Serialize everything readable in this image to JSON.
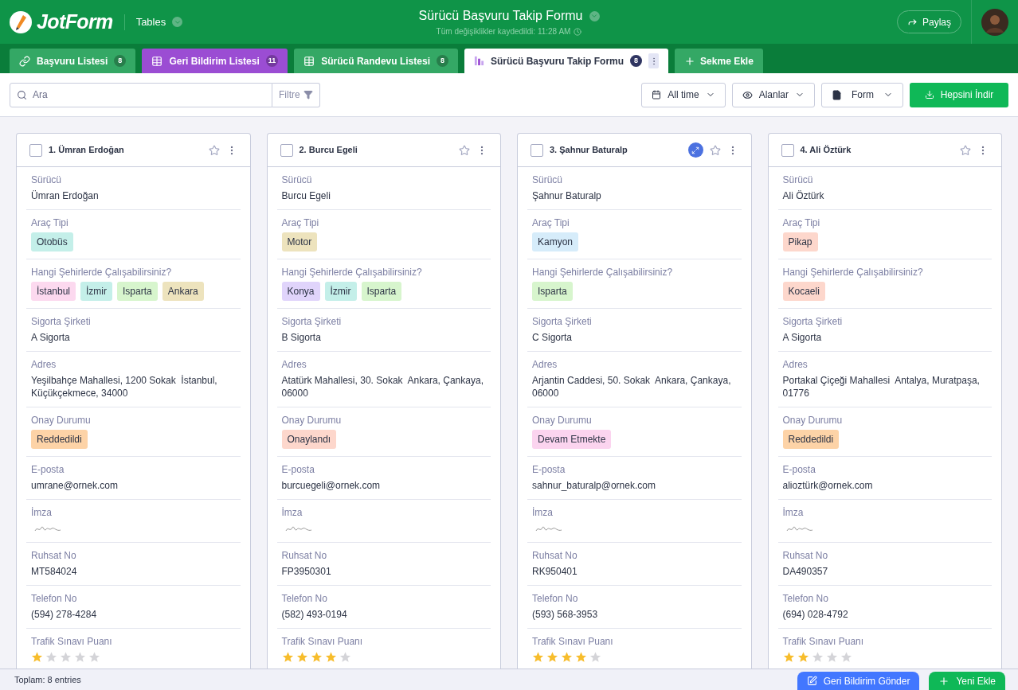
{
  "header": {
    "logo": "JotForm",
    "app": "Tables",
    "title": "Sürücü Başvuru Takip Formu",
    "saved": "Tüm değişiklikler kaydedildi: 11:28 AM",
    "share": "Paylaş"
  },
  "tabs": [
    {
      "label": "Başvuru Listesi",
      "count": "8",
      "kind": "link",
      "color": "#34a865",
      "selected": false
    },
    {
      "label": "Geri Bildirim Listesi",
      "count": "11",
      "kind": "table",
      "color": "#9b4dd3",
      "selected": false
    },
    {
      "label": "Sürücü Randevu Listesi",
      "count": "8",
      "kind": "table",
      "color": "#34a865",
      "selected": false
    },
    {
      "label": "Sürücü Başvuru Takip Formu",
      "count": "8",
      "kind": "report",
      "color": "#ffffff",
      "selected": true
    }
  ],
  "add_tab": "Sekme Ekle",
  "toolbar": {
    "search": {
      "placeholder": "Ara"
    },
    "filter": "Filtre",
    "date": "All time",
    "fields": "Alanlar",
    "form": "Form",
    "download": "Hepsini İndir"
  },
  "cards": [
    {
      "title": "1. Ümran Erdoğan",
      "checked": false,
      "starred": false,
      "hovered": false,
      "fields": [
        {
          "kind": "text",
          "label": "Sürücü",
          "value": "Ümran Erdoğan"
        },
        {
          "kind": "tags",
          "label": "Araç Tipi",
          "tags": [
            {
              "text": "Otobüs",
              "color": "#c4efe9"
            }
          ]
        },
        {
          "kind": "tags",
          "label": "Hangi Şehirlerde Çalışabilirsiniz?",
          "tags": [
            {
              "text": "İstanbul",
              "color": "#fcd9ef"
            },
            {
              "text": "İzmir",
              "color": "#c4efe9"
            },
            {
              "text": "Isparta",
              "color": "#d7f5cd"
            },
            {
              "text": "Ankara",
              "color": "#ede3bd"
            }
          ]
        },
        {
          "kind": "text",
          "label": "Sigorta Şirketi",
          "value": "A Sigorta"
        },
        {
          "kind": "text",
          "label": "Adres",
          "value": "Yeşilbahçe Mahallesi, 1200 Sokak  İstanbul, Küçükçekmece, 34000"
        },
        {
          "kind": "tags",
          "label": "Onay Durumu",
          "tags": [
            {
              "text": "Reddedildi",
              "color": "#fdd3a7"
            }
          ]
        },
        {
          "kind": "text",
          "label": "E-posta",
          "value": "umrane@ornek.com"
        },
        {
          "kind": "signature",
          "label": "İmza"
        },
        {
          "kind": "text",
          "label": "Ruhsat No",
          "value": "MT584024"
        },
        {
          "kind": "text",
          "label": "Telefon No",
          "value": "(594) 278-4284"
        },
        {
          "kind": "stars",
          "label": "Trafik Sınavı Puanı",
          "stars": 1
        }
      ]
    },
    {
      "title": "2. Burcu Egeli",
      "checked": false,
      "starred": false,
      "hovered": false,
      "fields": [
        {
          "kind": "text",
          "label": "Sürücü",
          "value": "Burcu Egeli"
        },
        {
          "kind": "tags",
          "label": "Araç Tipi",
          "tags": [
            {
              "text": "Motor",
              "color": "#ede3bd"
            }
          ]
        },
        {
          "kind": "tags",
          "label": "Hangi Şehirlerde Çalışabilirsiniz?",
          "tags": [
            {
              "text": "Konya",
              "color": "#e0d4fb"
            },
            {
              "text": "İzmir",
              "color": "#c4efe9"
            },
            {
              "text": "Isparta",
              "color": "#d7f5cd"
            }
          ]
        },
        {
          "kind": "text",
          "label": "Sigorta Şirketi",
          "value": "B Sigorta"
        },
        {
          "kind": "text",
          "label": "Adres",
          "value": "Atatürk Mahallesi, 30. Sokak  Ankara, Çankaya, 06000"
        },
        {
          "kind": "tags",
          "label": "Onay Durumu",
          "tags": [
            {
              "text": "Onaylandı",
              "color": "#fdd7cc"
            }
          ]
        },
        {
          "kind": "text",
          "label": "E-posta",
          "value": "burcuegeli@ornek.com"
        },
        {
          "kind": "signature",
          "label": "İmza"
        },
        {
          "kind": "text",
          "label": "Ruhsat No",
          "value": "FP3950301"
        },
        {
          "kind": "text",
          "label": "Telefon No",
          "value": "(582) 493-0194"
        },
        {
          "kind": "stars",
          "label": "Trafik Sınavı Puanı",
          "stars": 4
        }
      ]
    },
    {
      "title": "3. Şahnur Baturalp",
      "checked": false,
      "starred": false,
      "hovered": true,
      "fields": [
        {
          "kind": "text",
          "label": "Sürücü",
          "value": "Şahnur Baturalp"
        },
        {
          "kind": "tags",
          "label": "Araç Tipi",
          "tags": [
            {
              "text": "Kamyon",
              "color": "#d6ecfa"
            }
          ]
        },
        {
          "kind": "tags",
          "label": "Hangi Şehirlerde Çalışabilirsiniz?",
          "tags": [
            {
              "text": "Isparta",
              "color": "#d7f5cd"
            }
          ]
        },
        {
          "kind": "text",
          "label": "Sigorta Şirketi",
          "value": "C Sigorta"
        },
        {
          "kind": "text",
          "label": "Adres",
          "value": "Arjantin Caddesi, 50. Sokak  Ankara, Çankaya, 06000"
        },
        {
          "kind": "tags",
          "label": "Onay Durumu",
          "tags": [
            {
              "text": "Devam Etmekte",
              "color": "#fbd4ef"
            }
          ]
        },
        {
          "kind": "text",
          "label": "E-posta",
          "value": "sahnur_baturalp@ornek.com"
        },
        {
          "kind": "signature",
          "label": "İmza"
        },
        {
          "kind": "text",
          "label": "Ruhsat No",
          "value": "RK950401"
        },
        {
          "kind": "text",
          "label": "Telefon No",
          "value": "(593) 568-3953"
        },
        {
          "kind": "stars",
          "label": "Trafik Sınavı Puanı",
          "stars": 4
        }
      ]
    },
    {
      "title": "4. Ali Öztürk",
      "checked": false,
      "starred": false,
      "hovered": false,
      "fields": [
        {
          "kind": "text",
          "label": "Sürücü",
          "value": "Ali Öztürk"
        },
        {
          "kind": "tags",
          "label": "Araç Tipi",
          "tags": [
            {
              "text": "Pikap",
              "color": "#fdd7cc"
            }
          ]
        },
        {
          "kind": "tags",
          "label": "Hangi Şehirlerde Çalışabilirsiniz?",
          "tags": [
            {
              "text": "Kocaeli",
              "color": "#fdd7cc"
            }
          ]
        },
        {
          "kind": "text",
          "label": "Sigorta Şirketi",
          "value": "A Sigorta"
        },
        {
          "kind": "text",
          "label": "Adres",
          "value": "Portakal Çiçeği Mahallesi  Antalya, Muratpaşa, 01776"
        },
        {
          "kind": "tags",
          "label": "Onay Durumu",
          "tags": [
            {
              "text": "Reddedildi",
              "color": "#fdd3a7"
            }
          ]
        },
        {
          "kind": "text",
          "label": "E-posta",
          "value": "alioztürk@ornek.com"
        },
        {
          "kind": "signature",
          "label": "İmza"
        },
        {
          "kind": "text",
          "label": "Ruhsat No",
          "value": "DA490357"
        },
        {
          "kind": "text",
          "label": "Telefon No",
          "value": "(694) 028-4792"
        },
        {
          "kind": "stars",
          "label": "Trafik Sınavı Puanı",
          "stars": 2
        }
      ]
    }
  ],
  "footer": {
    "total": "Toplam: 8 entries",
    "feedback": "Geri Bildirim Gönder",
    "add": "Yeni Ekle"
  }
}
